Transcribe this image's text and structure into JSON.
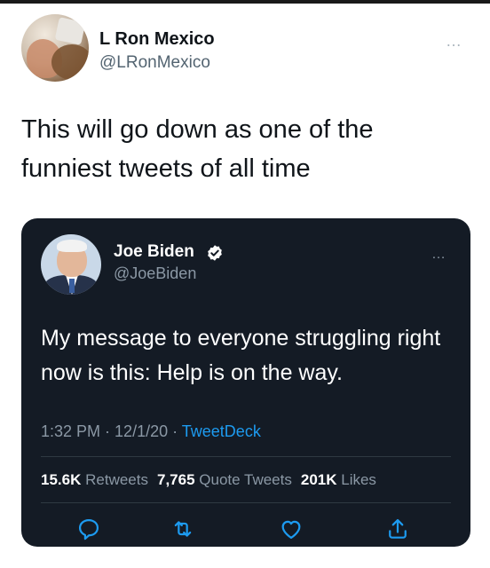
{
  "outer_tweet": {
    "display_name": "L Ron Mexico",
    "handle": "@LRonMexico",
    "more_glyph": "…",
    "text": "This will go down as one of the funniest tweets of all time"
  },
  "quoted_tweet": {
    "display_name": "Joe Biden",
    "handle": "@JoeBiden",
    "more_glyph": "…",
    "text": "My message to everyone struggling right now is this: Help is on the way.",
    "time": "1:32 PM",
    "date": "12/1/20",
    "source": "TweetDeck",
    "separator": " · ",
    "stats": {
      "retweets_count": "15.6K",
      "retweets_label": "Retweets",
      "quote_count": "7,765",
      "quote_label": "Quote Tweets",
      "likes_count": "201K",
      "likes_label": "Likes"
    },
    "icons": [
      "reply-icon",
      "retweet-icon",
      "like-icon",
      "share-icon"
    ]
  },
  "colors": {
    "card_background": "#141b25",
    "link_blue": "#1d9bf0",
    "muted_text": "#8b98a5"
  }
}
